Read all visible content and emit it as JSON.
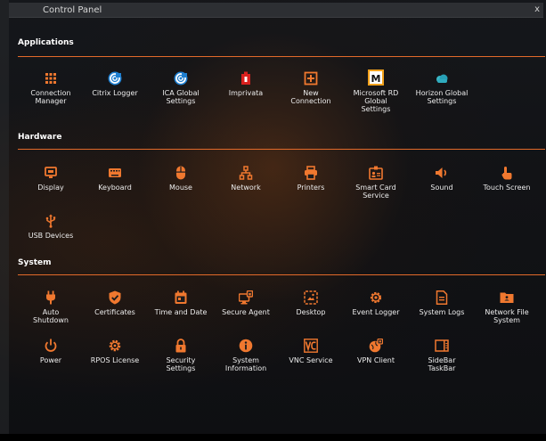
{
  "window": {
    "title": "Control Panel",
    "close_label": "x"
  },
  "colors": {
    "accent": "#f0782f",
    "text": "#ececec"
  },
  "sections": {
    "applications": {
      "title": "Applications",
      "items": [
        {
          "label": "Connection\nManager",
          "icon": "grid-icon"
        },
        {
          "label": "Citrix Logger",
          "icon": "citrix-icon"
        },
        {
          "label": "ICA Global\nSettings",
          "icon": "citrix-icon"
        },
        {
          "label": "Imprivata",
          "icon": "imprivata-icon"
        },
        {
          "label": "New\nConnection",
          "icon": "add-icon"
        },
        {
          "label": "Microsoft RD\nGlobal\nSettings",
          "icon": "microsoft-rd-icon"
        },
        {
          "label": "Horizon Global\nSettings",
          "icon": "cloud-icon"
        }
      ]
    },
    "hardware": {
      "title": "Hardware",
      "items": [
        {
          "label": "Display",
          "icon": "display-icon"
        },
        {
          "label": "Keyboard",
          "icon": "keyboard-icon"
        },
        {
          "label": "Mouse",
          "icon": "mouse-icon"
        },
        {
          "label": "Network",
          "icon": "network-icon"
        },
        {
          "label": "Printers",
          "icon": "printer-icon"
        },
        {
          "label": "Smart Card\nService",
          "icon": "smart-card-icon"
        },
        {
          "label": "Sound",
          "icon": "sound-icon"
        },
        {
          "label": "Touch Screen",
          "icon": "touch-icon"
        },
        {
          "label": "USB Devices",
          "icon": "usb-icon"
        }
      ]
    },
    "system": {
      "title": "System",
      "items": [
        {
          "label": "Auto\nShutdown",
          "icon": "plug-icon"
        },
        {
          "label": "Certificates",
          "icon": "certificate-icon"
        },
        {
          "label": "Time and Date",
          "icon": "calendar-icon"
        },
        {
          "label": "Secure Agent",
          "icon": "secure-agent-icon"
        },
        {
          "label": "Desktop",
          "icon": "desktop-icon"
        },
        {
          "label": "Event Logger",
          "icon": "event-logger-icon"
        },
        {
          "label": "System Logs",
          "icon": "logs-icon"
        },
        {
          "label": "Network File\nSystem",
          "icon": "folder-icon"
        },
        {
          "label": "Power",
          "icon": "power-icon"
        },
        {
          "label": "RPOS License",
          "icon": "license-icon"
        },
        {
          "label": "Security\nSettings",
          "icon": "lock-icon"
        },
        {
          "label": "System\nInformation",
          "icon": "info-icon"
        },
        {
          "label": "VNC Service",
          "icon": "vnc-icon"
        },
        {
          "label": "VPN Client",
          "icon": "vpn-icon"
        },
        {
          "label": "SideBar\nTaskBar",
          "icon": "sidebar-icon"
        }
      ]
    }
  }
}
